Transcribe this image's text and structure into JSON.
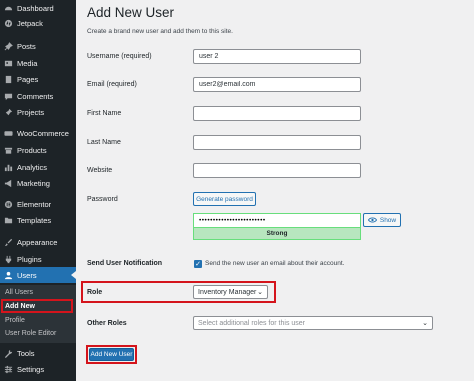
{
  "sidebar": {
    "items": [
      {
        "label": "Dashboard",
        "icon": "dashboard-icon"
      },
      {
        "label": "Jetpack",
        "icon": "jetpack-icon"
      },
      {
        "label": "Posts",
        "icon": "pin-icon"
      },
      {
        "label": "Media",
        "icon": "media-icon"
      },
      {
        "label": "Pages",
        "icon": "page-icon"
      },
      {
        "label": "Comments",
        "icon": "comment-icon"
      },
      {
        "label": "Projects",
        "icon": "pin-icon"
      },
      {
        "label": "WooCommerce",
        "icon": "woocommerce-icon"
      },
      {
        "label": "Products",
        "icon": "archive-icon"
      },
      {
        "label": "Analytics",
        "icon": "chart-icon"
      },
      {
        "label": "Marketing",
        "icon": "megaphone-icon"
      },
      {
        "label": "Elementor",
        "icon": "elementor-icon"
      },
      {
        "label": "Templates",
        "icon": "folder-icon"
      },
      {
        "label": "Appearance",
        "icon": "brush-icon"
      },
      {
        "label": "Plugins",
        "icon": "plugin-icon"
      },
      {
        "label": "Users",
        "icon": "users-icon"
      },
      {
        "label": "Tools",
        "icon": "wrench-icon"
      },
      {
        "label": "Settings",
        "icon": "settings-icon"
      }
    ],
    "submenu": [
      "All Users",
      "Add New",
      "Profile",
      "User Role Editor"
    ]
  },
  "page": {
    "title": "Add New User",
    "intro": "Create a brand new user and add them to this site."
  },
  "form": {
    "username_label": "Username (required)",
    "username_value": "user 2",
    "email_label": "Email (required)",
    "email_value": "user2@email.com",
    "first_name_label": "First Name",
    "last_name_label": "Last Name",
    "website_label": "Website",
    "password_label": "Password",
    "generate_password": "Generate password",
    "password_value": "••••••••••••••••••••••••",
    "show_label": "Show",
    "strength": "Strong",
    "notification_label": "Send User Notification",
    "notification_text": "Send the new user an email about their account.",
    "role_label": "Role",
    "role_value": "Inventory Manager",
    "other_roles_label": "Other Roles",
    "other_roles_placeholder": "Select additional roles for this user",
    "submit": "Add New User"
  },
  "colors": {
    "sidebar_bg": "#1d2327",
    "accent": "#2271b1",
    "highlight": "#d4141c",
    "strength_bg": "#b8e6bf"
  }
}
